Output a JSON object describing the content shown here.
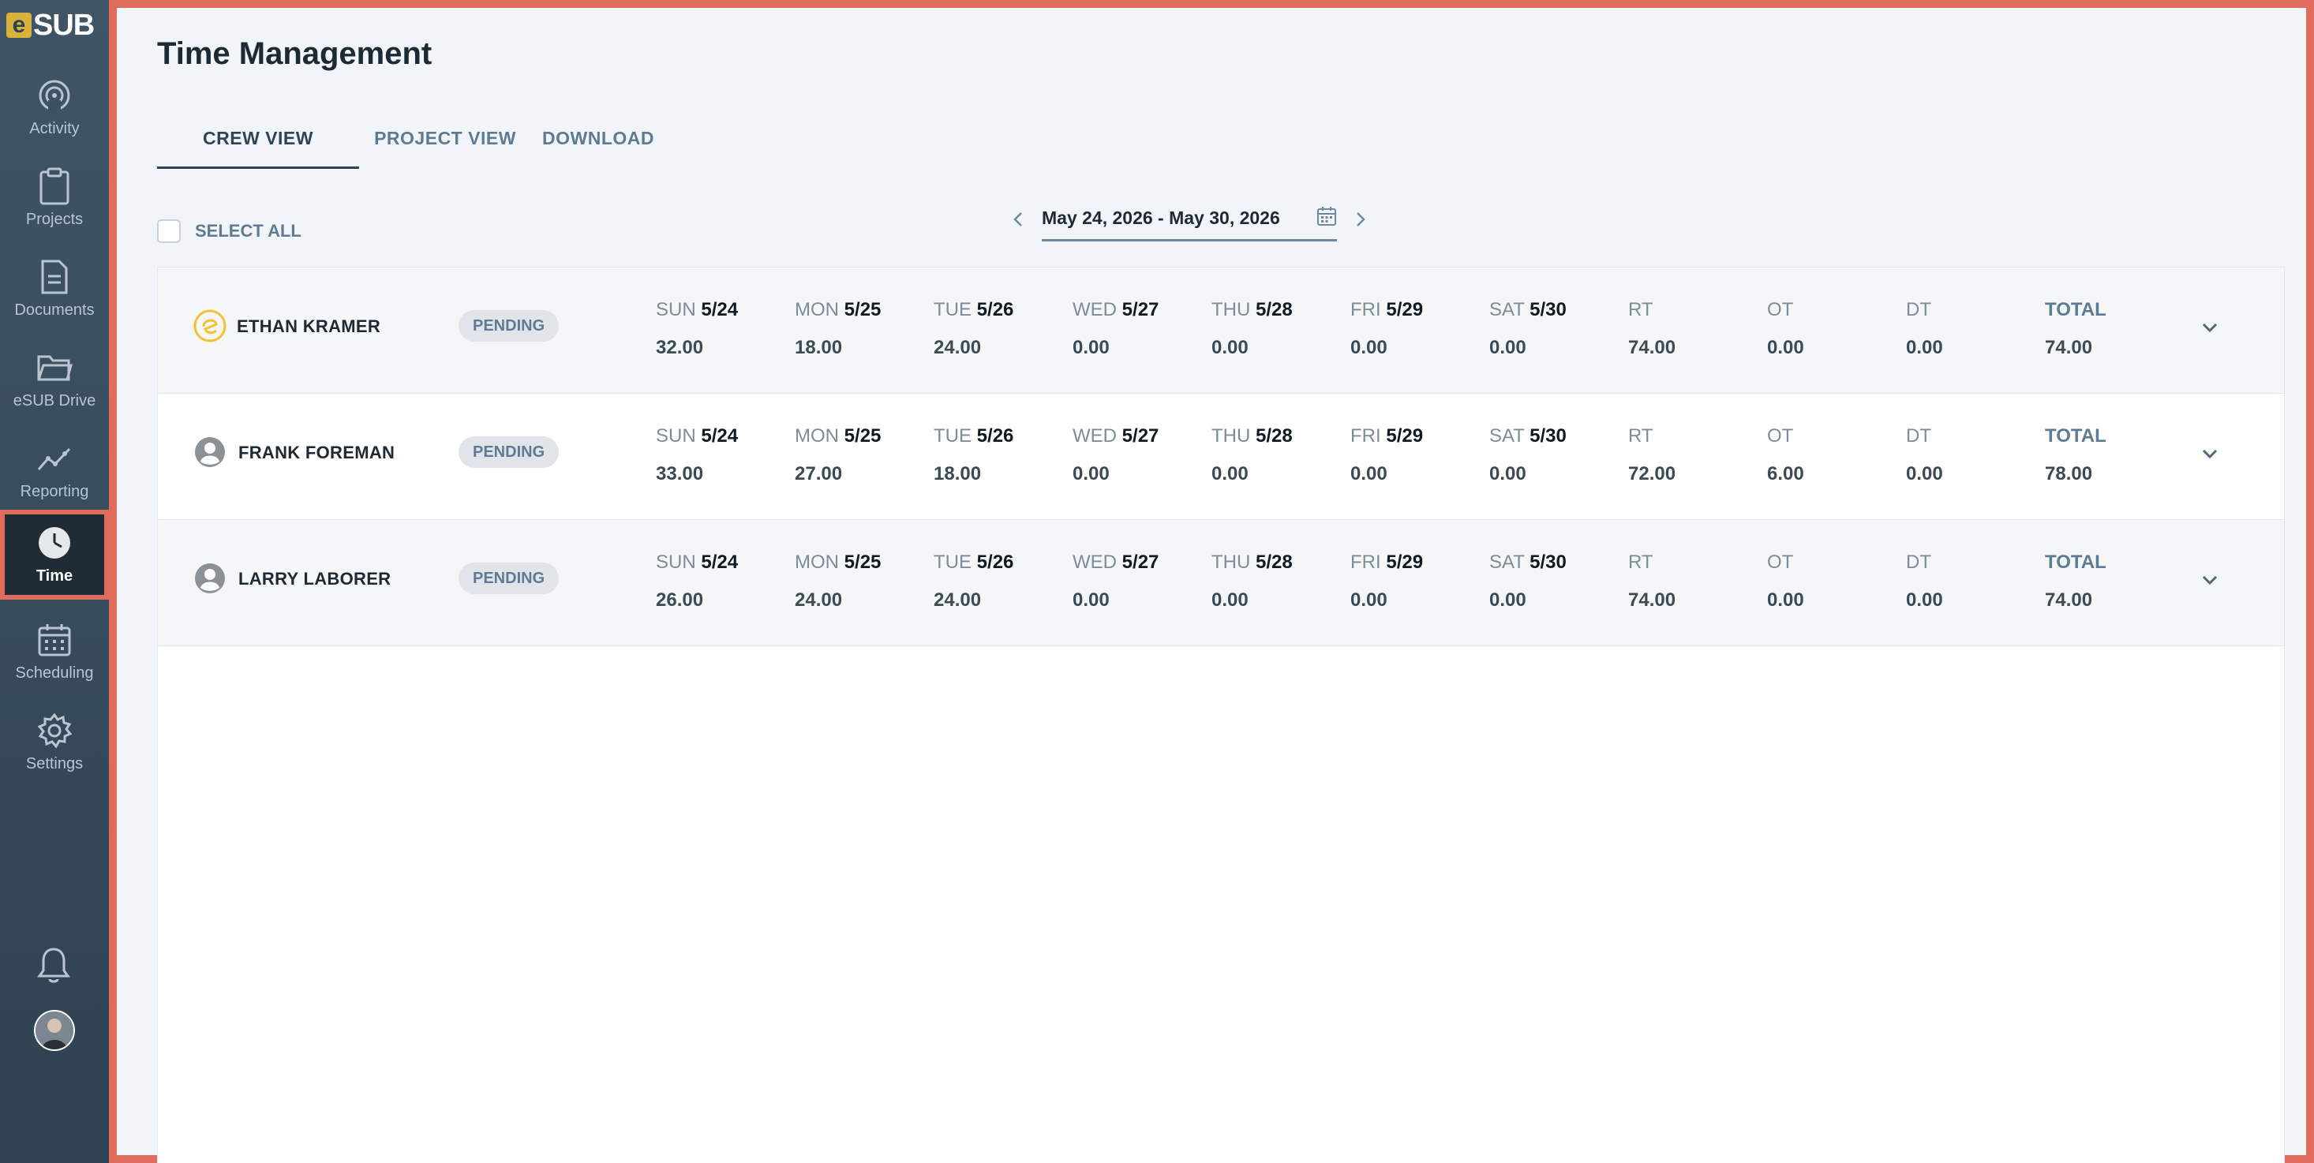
{
  "app": {
    "logo_e": "e",
    "logo_rest": "SUB",
    "accent_color": "#e06c5d"
  },
  "sidebar": {
    "items": [
      {
        "label": "Activity",
        "icon": "activity-icon"
      },
      {
        "label": "Projects",
        "icon": "clipboard-icon"
      },
      {
        "label": "Documents",
        "icon": "document-icon"
      },
      {
        "label": "eSUB Drive",
        "icon": "folder-icon"
      },
      {
        "label": "Reporting",
        "icon": "chart-icon"
      },
      {
        "label": "Time",
        "icon": "clock-icon",
        "active": true
      },
      {
        "label": "Scheduling",
        "icon": "calendar-icon"
      },
      {
        "label": "Settings",
        "icon": "gear-icon"
      }
    ]
  },
  "page": {
    "title": "Time Management"
  },
  "tabs": [
    {
      "label": "CREW VIEW",
      "active": true
    },
    {
      "label": "PROJECT VIEW"
    },
    {
      "label": "DOWNLOAD"
    }
  ],
  "select_all": {
    "label": "SELECT ALL"
  },
  "date_range": {
    "label": "May 24, 2026 - May 30, 2026"
  },
  "columns": [
    {
      "day": "SUN",
      "date": "5/24"
    },
    {
      "day": "MON",
      "date": "5/25"
    },
    {
      "day": "TUE",
      "date": "5/26"
    },
    {
      "day": "WED",
      "date": "5/27"
    },
    {
      "day": "THU",
      "date": "5/28"
    },
    {
      "day": "FRI",
      "date": "5/29"
    },
    {
      "day": "SAT",
      "date": "5/30"
    },
    {
      "day": "RT",
      "date": ""
    },
    {
      "day": "OT",
      "date": ""
    },
    {
      "day": "DT",
      "date": ""
    },
    {
      "day": "TOTAL",
      "date": ""
    }
  ],
  "crew": [
    {
      "name": "ETHAN KRAMER",
      "avatar": "esub-user-icon",
      "status": "PENDING",
      "values": [
        "32.00",
        "18.00",
        "24.00",
        "0.00",
        "0.00",
        "0.00",
        "0.00",
        "74.00",
        "0.00",
        "0.00",
        "74.00"
      ]
    },
    {
      "name": "FRANK FOREMAN",
      "avatar": "person-icon",
      "status": "PENDING",
      "values": [
        "33.00",
        "27.00",
        "18.00",
        "0.00",
        "0.00",
        "0.00",
        "0.00",
        "72.00",
        "6.00",
        "0.00",
        "78.00"
      ]
    },
    {
      "name": "LARRY LABORER",
      "avatar": "person-icon",
      "status": "PENDING",
      "values": [
        "26.00",
        "24.00",
        "24.00",
        "0.00",
        "0.00",
        "0.00",
        "0.00",
        "74.00",
        "0.00",
        "0.00",
        "74.00"
      ]
    }
  ]
}
